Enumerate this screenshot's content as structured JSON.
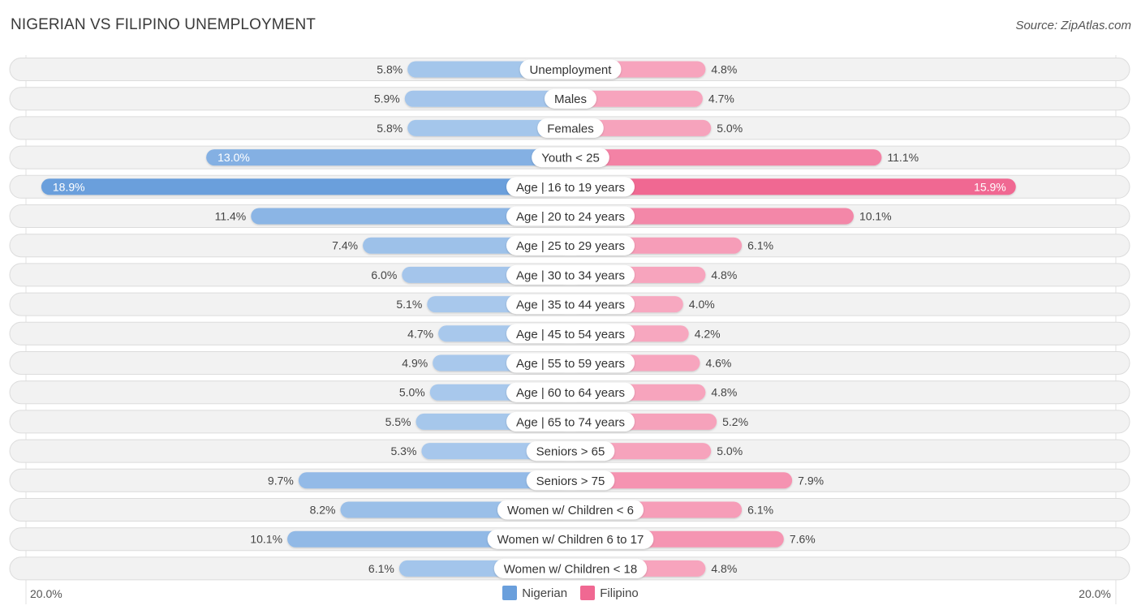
{
  "title": "NIGERIAN VS FILIPINO UNEMPLOYMENT",
  "source": "Source: ZipAtlas.com",
  "colors": {
    "nigerian": "#6a9fdc",
    "nigerian_light": "#a8c8ec",
    "filipino": "#f06892",
    "filipino_light": "#f7a8c0"
  },
  "axis": {
    "left_label": "20.0%",
    "right_label": "20.0%"
  },
  "legend": [
    {
      "label": "Nigerian",
      "color": "#6a9fdc"
    },
    {
      "label": "Filipino",
      "color": "#f06892"
    }
  ],
  "chart_data": {
    "type": "bar",
    "orientation": "horizontal-diverging",
    "title": "NIGERIAN VS FILIPINO UNEMPLOYMENT",
    "xlim": [
      -20,
      20
    ],
    "xlabel": "",
    "ylabel": "",
    "legend_position": "bottom-center",
    "categories": [
      "Unemployment",
      "Males",
      "Females",
      "Youth < 25",
      "Age | 16 to 19 years",
      "Age | 20 to 24 years",
      "Age | 25 to 29 years",
      "Age | 30 to 34 years",
      "Age | 35 to 44 years",
      "Age | 45 to 54 years",
      "Age | 55 to 59 years",
      "Age | 60 to 64 years",
      "Age | 65 to 74 years",
      "Seniors > 65",
      "Seniors > 75",
      "Women w/ Children < 6",
      "Women w/ Children 6 to 17",
      "Women w/ Children < 18"
    ],
    "series": [
      {
        "name": "Nigerian",
        "side": "left",
        "values": [
          5.8,
          5.9,
          5.8,
          13.0,
          18.9,
          11.4,
          7.4,
          6.0,
          5.1,
          4.7,
          4.9,
          5.0,
          5.5,
          5.3,
          9.7,
          8.2,
          10.1,
          6.1
        ]
      },
      {
        "name": "Filipino",
        "side": "right",
        "values": [
          4.8,
          4.7,
          5.0,
          11.1,
          15.9,
          10.1,
          6.1,
          4.8,
          4.0,
          4.2,
          4.6,
          4.8,
          5.2,
          5.0,
          7.9,
          6.1,
          7.6,
          4.8
        ]
      }
    ],
    "value_format": "{v}%"
  }
}
